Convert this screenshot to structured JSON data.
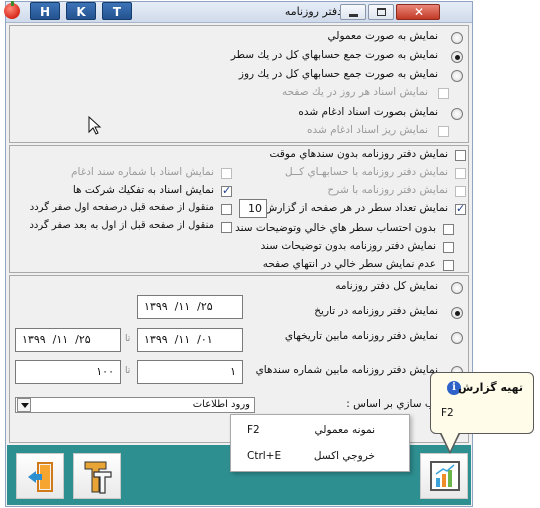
{
  "toolbar": {
    "h_label": "H",
    "k_label": "K",
    "t_label": "T"
  },
  "window": {
    "title": "دفتر روزنامه"
  },
  "section1": {
    "items": [
      {
        "label": "نمايش به صورت معمولي",
        "checked": false,
        "enabled": true
      },
      {
        "label": "نمايش به صورت جمع حسابهاي كل در يك سطر",
        "checked": true,
        "enabled": true
      },
      {
        "label": "نمايش به صورت جمع حسابهاي كل در يك روز",
        "checked": false,
        "enabled": true
      },
      {
        "label": "نمايش اسناد هر روز در يك صفحه",
        "checked": false,
        "enabled": false
      },
      {
        "label": "نمايش بصورت اسناد ادغام شده",
        "checked": false,
        "enabled": true
      },
      {
        "label": "نمايش ريز اسناد ادغام شده",
        "checked": false,
        "enabled": false
      }
    ]
  },
  "section2": {
    "right_items": [
      {
        "label": "نمايش دفتر روزنامه بدون سندهاي موقت",
        "checked": false,
        "enabled": true
      },
      {
        "label": "نمايش دفتر روزنامه با حسابهـاي كــل",
        "checked": false,
        "enabled": false
      },
      {
        "label": "نمايش دفتر روزنامه با شرح",
        "checked": false,
        "enabled": false
      },
      {
        "label": "نمايش تعداد سطر در هر صفحه از گزارش",
        "checked": true,
        "enabled": true,
        "value": "10"
      },
      {
        "label": "بدون احتساب سطر هاي خالي وتوضيحات سند",
        "checked": false,
        "enabled": true
      },
      {
        "label": "نمايش دفتر روزنامه بدون توضيحات سند",
        "checked": false,
        "enabled": true
      },
      {
        "label": "عدم نمايش سطر خالي در انتهاي صفحه",
        "checked": false,
        "enabled": true
      }
    ],
    "left_items": [
      {
        "label": "نمايش اسناد با شماره سند ادغام",
        "checked": false,
        "enabled": false
      },
      {
        "label": "نمايش اسناد به تفكيك شركت ها",
        "checked": true,
        "enabled": true
      },
      {
        "label": "منقول از صفحه قبل درصفحه اول صفر گردد",
        "checked": false,
        "enabled": true
      },
      {
        "label": "منقول از صفحه قبل از اول به بعد صفر گردد",
        "checked": false,
        "enabled": true
      }
    ]
  },
  "section3": {
    "options": [
      {
        "label": "نمايش كل دفتر روزنامه",
        "checked": false
      },
      {
        "label": "نمايش دفتر روزنامه در تاريخ",
        "checked": true
      },
      {
        "label": "نمايش دفتر روزنامه مابين تاريخهاي",
        "checked": false
      },
      {
        "label": "نمايش دفتر روزنامه مابين شماره سندهاي",
        "checked": false
      }
    ],
    "date_single": "۱۳۹۹  /۱۱  /۲۵",
    "date_from": "۱۳۹۹  /۱۱  /۰۱",
    "date_to": "۱۳۹۹  /۱۱  /۲۵",
    "doc_from": "۱",
    "doc_to": "۱۰۰",
    "to_label": "تا",
    "sort_label": "ترتيب سازي بر اساس :",
    "sort_value": "ورود اطلاعات"
  },
  "context_menu": {
    "items": [
      {
        "label": "نمونه معمولي",
        "shortcut": "F2"
      },
      {
        "label": "خروجي اكسل",
        "shortcut": "Ctrl+E"
      }
    ]
  },
  "tooltip": {
    "title": "تهيه گزارش",
    "shortcut": "F2"
  },
  "colors": {
    "accent_teal": "#2e8f91",
    "tooltip_bg": "#fffde9",
    "hkt_blue": "#2f5f9e"
  },
  "icons": {
    "exit": "exit-door-icon",
    "font": "font-tt-icon",
    "report": "bar-chart-icon",
    "info": "info-icon"
  }
}
